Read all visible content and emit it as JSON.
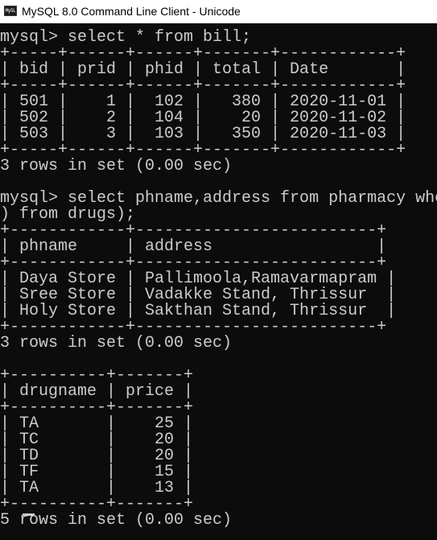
{
  "window": {
    "title": "MySQL 8.0 Command Line Client - Unicode",
    "icon_label": "My5L",
    "icon_name": "mysql-console-icon"
  },
  "console": {
    "lines": [
      "mysql> select * from bill;",
      "+-----+------+------+-------+------------+",
      "| bid | prid | phid | total | Date       |",
      "+-----+------+------+-------+------------+",
      "| 501 |    1 |  102 |   380 | 2020-11-01 |",
      "| 502 |    2 |  104 |    20 | 2020-11-02 |",
      "| 503 |    3 |  103 |   350 | 2020-11-03 |",
      "+-----+------+------+-------+------------+",
      "3 rows in set (0.00 sec)",
      "",
      "mysql> select phname,address from pharmacy whe",
      ") from drugs);",
      "+------------+-------------------------+",
      "| phname     | address                 |",
      "+------------+-------------------------+",
      "| Daya Store | Pallimoola,Ramavarmapram |",
      "| Sree Store | Vadakke Stand, Thrissur  |",
      "| Holy Store | Sakthan Stand, Thrissur  |",
      "+------------+-------------------------+",
      "3 rows in set (0.00 sec)",
      "",
      "+----------+-------+",
      "| drugname | price |",
      "+----------+-------+",
      "| TA       |    25 |",
      "| TC       |    20 |",
      "| TD       |    20 |",
      "| TF       |    15 |",
      "| TA       |    13 |",
      "+----------+-------+",
      "5 rows in set (0.00 sec)"
    ]
  }
}
